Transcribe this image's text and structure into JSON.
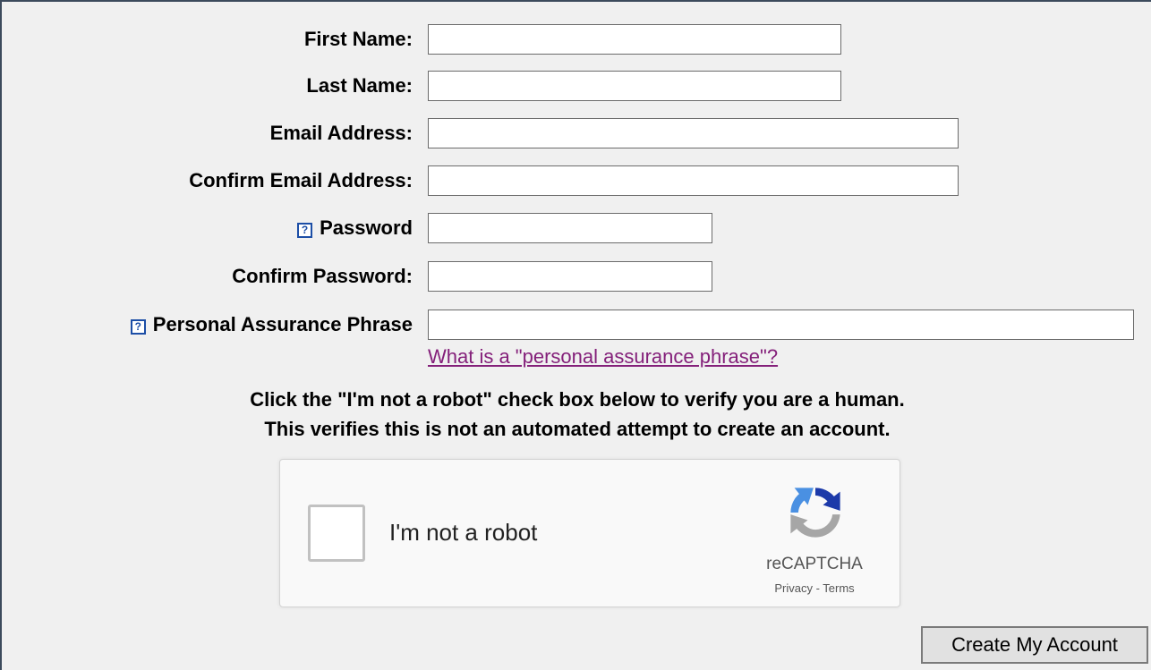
{
  "form": {
    "first_name_label": "First Name:",
    "last_name_label": "Last Name:",
    "email_label": "Email Address:",
    "confirm_email_label": "Confirm Email Address:",
    "password_label": "Password",
    "confirm_password_label": "Confirm Password:",
    "phrase_label": "Personal Assurance Phrase",
    "help_icon_glyph": "?",
    "first_name_value": "",
    "last_name_value": "",
    "email_value": "",
    "confirm_email_value": "",
    "password_value": "",
    "confirm_password_value": "",
    "phrase_value": "",
    "phrase_link": "What is a \"personal assurance phrase\"?"
  },
  "instructions": {
    "line1": "Click the \"I'm not a robot\" check box below to verify you are a human.",
    "line2": "This verifies this is not an automated attempt to create an account."
  },
  "captcha": {
    "checkbox_label": "I'm not a robot",
    "brand": "reCAPTCHA",
    "privacy_link": "Privacy",
    "separator": " - ",
    "terms_link": "Terms",
    "logo_icon": "recaptcha-logo-icon",
    "colors": {
      "blue": "#1c3aa9",
      "light_blue": "#4a90e2",
      "gray": "#a6a6a6"
    }
  },
  "actions": {
    "create_account_label": "Create My Account"
  },
  "colors": {
    "background": "#f0f0f0",
    "link_visited": "#84207a",
    "help_icon": "#1c4ea6",
    "frame_border": "#3c4a5c"
  }
}
